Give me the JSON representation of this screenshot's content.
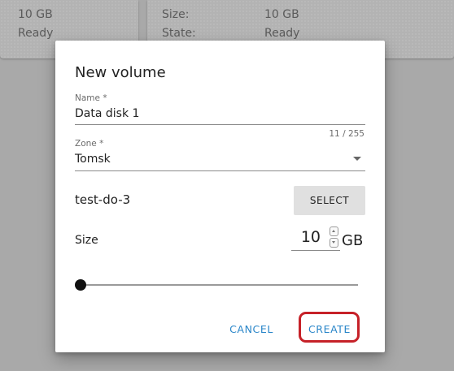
{
  "background_cards": {
    "left": {
      "size_value": "10 GB",
      "state_value": "Ready"
    },
    "right": {
      "size_label": "Size:",
      "size_value": "10 GB",
      "state_label": "State:",
      "state_value": "Ready"
    }
  },
  "dialog": {
    "title": "New volume",
    "name_field": {
      "label": "Name *",
      "value": "Data disk 1",
      "counter": "11 / 255"
    },
    "zone_field": {
      "label": "Zone *",
      "value": "Tomsk",
      "icon": "dropdown-arrow-icon"
    },
    "image_row": {
      "value": "test-do-3",
      "button_label": "SELECT"
    },
    "size_row": {
      "label": "Size",
      "value": "10",
      "unit": "GB",
      "slider_fraction": 0
    },
    "actions": {
      "cancel_label": "CANCEL",
      "create_label": "CREATE"
    },
    "colors": {
      "accent": "#2a86c9",
      "highlight": "#c62128"
    }
  }
}
